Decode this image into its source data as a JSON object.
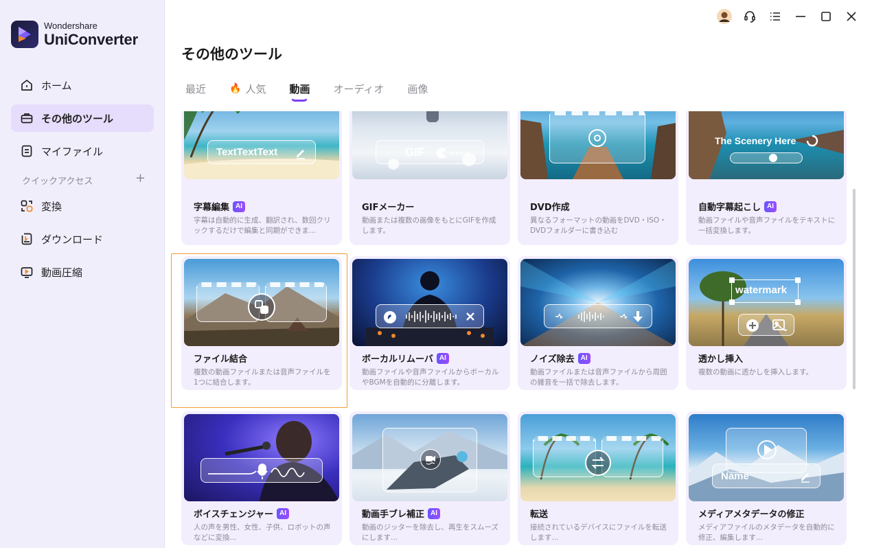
{
  "brand": {
    "small": "Wondershare",
    "big": "UniConverter"
  },
  "nav": [
    {
      "label": "ホーム",
      "icon": "home-icon"
    },
    {
      "label": "その他のツール",
      "icon": "toolbox-icon",
      "active": true
    },
    {
      "label": "マイファイル",
      "icon": "file-icon"
    }
  ],
  "quick_access": {
    "label": "クイックアクセス",
    "add": "+"
  },
  "quick_items": [
    {
      "label": "変換",
      "icon": "convert-icon"
    },
    {
      "label": "ダウンロード",
      "icon": "download-icon"
    },
    {
      "label": "動画圧縮",
      "icon": "compress-icon"
    }
  ],
  "page_title": "その他のツール",
  "tabs": [
    {
      "label": "最近"
    },
    {
      "label": "人気",
      "icon": "fire-icon",
      "glyph": "🔥"
    },
    {
      "label": "動画",
      "active": true
    },
    {
      "label": "オーディオ"
    },
    {
      "label": "画像"
    }
  ],
  "cards": [
    {
      "title": "字幕編集",
      "ai": true,
      "desc": "字幕は自動的に生成、翻訳され、数回クリックするだけで編集と同期ができま...",
      "overlay": "TextTextText"
    },
    {
      "title": "GIFメーカー",
      "ai": false,
      "desc": "動画または複数の画像をもとにGIFを作成します。",
      "overlay": "GIF"
    },
    {
      "title": "DVD作成",
      "ai": false,
      "desc": "異なるフォーマットの動画をDVD・ISO・DVDフォルダーに書き込む"
    },
    {
      "title": "自動字幕起こし",
      "ai": true,
      "desc": "動画ファイルや音声ファイルをテキストに一括変換します。",
      "overlay": "The Scenery Here"
    },
    {
      "title": "ファイル結合",
      "ai": false,
      "desc": "複数の動画ファイルまたは音声ファイルを1つに結合します。"
    },
    {
      "title": "ボーカルリムーバ",
      "ai": true,
      "desc": "動画ファイルや音声ファイルからボーカルやBGMを自動的に分離します。"
    },
    {
      "title": "ノイズ除去",
      "ai": true,
      "desc": "動画ファイルまたは音声ファイルから周囲の雑音を一括で除去します。"
    },
    {
      "title": "透かし挿入",
      "ai": false,
      "desc": "複数の動画に透かしを挿入します。",
      "overlay": "watermark"
    },
    {
      "title": "ボイスチェンジャー",
      "ai": true,
      "desc": "人の声を男性、女性、子供、ロボットの声などに変換..."
    },
    {
      "title": "動画手ブレ補正",
      "ai": true,
      "desc": "動画のジッターを除去し、再生をスムーズにします..."
    },
    {
      "title": "転送",
      "ai": false,
      "desc": "接続されているデバイスにファイルを転送します..."
    },
    {
      "title": "メディアメタデータの修正",
      "ai": false,
      "desc": "メディアファイルのメタデータを自動的に修正、編集します...",
      "overlay": "Name"
    }
  ],
  "ai_label": "AI",
  "colors": {
    "accent": "#7b3ff2",
    "sidebar": "#f1eefc",
    "card": "#f3eefd",
    "highlight": "#f39a37"
  }
}
